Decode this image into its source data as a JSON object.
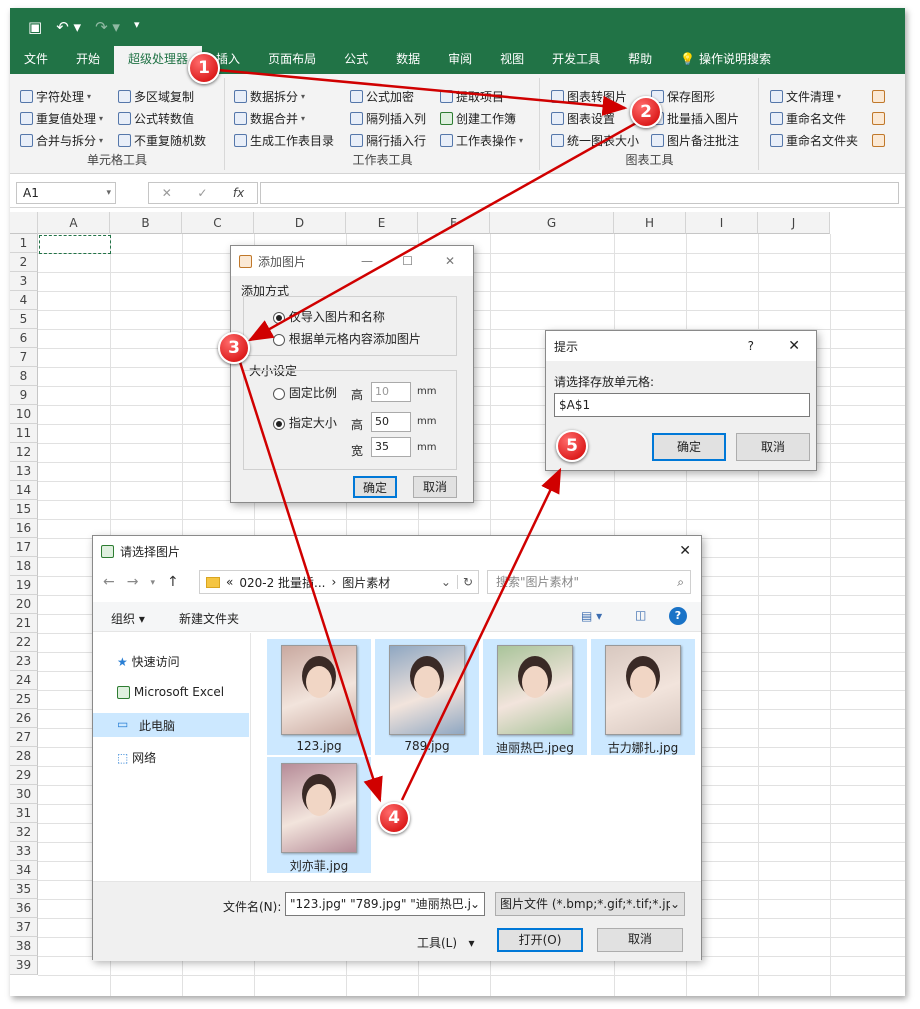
{
  "qat": {
    "save_icon": "save-icon",
    "undo_icon": "undo-icon",
    "redo_icon": "redo-icon"
  },
  "tabs": [
    "文件",
    "开始",
    "超级处理器",
    "插入",
    "页面布局",
    "公式",
    "数据",
    "审阅",
    "视图",
    "开发工具",
    "帮助"
  ],
  "tell_me": "操作说明搜索",
  "ribbon": {
    "cell_tools": {
      "title": "单元格工具",
      "items": [
        "字符处理",
        "多区域复制",
        "重复值处理",
        "公式转数值",
        "合并与拆分",
        "不重复随机数"
      ]
    },
    "sheet_tools": {
      "title": "工作表工具",
      "items": [
        "数据拆分",
        "公式加密",
        "提取项目",
        "数据合并",
        "隔列插入列",
        "创建工作簿",
        "生成工作表目录",
        "隔行插入行",
        "工作表操作"
      ]
    },
    "chart_tools": {
      "title": "图表工具",
      "items": [
        "图表转图片",
        "保存图形",
        "图表设置",
        "批量插入图片",
        "统一图表大小",
        "图片备注批注"
      ]
    },
    "file_tools": {
      "items": [
        "文件清理",
        "重命名文件",
        "重命名文件夹"
      ]
    }
  },
  "formula_bar": {
    "name_box": "A1",
    "formula": ""
  },
  "columns": [
    "A",
    "B",
    "C",
    "D",
    "E",
    "F",
    "G",
    "H",
    "I",
    "J"
  ],
  "rows": [
    "1",
    "2",
    "3",
    "4",
    "5",
    "6",
    "7",
    "8",
    "9",
    "10",
    "11",
    "12",
    "13",
    "14",
    "15",
    "16",
    "17",
    "18",
    "19",
    "20",
    "21",
    "22",
    "23",
    "24",
    "25",
    "26",
    "27",
    "28",
    "29",
    "30",
    "31",
    "32",
    "33",
    "34",
    "35",
    "36",
    "37",
    "38",
    "39"
  ],
  "add_dialog": {
    "title": "添加图片",
    "mode_label": "添加方式",
    "opt1": "仅导入图片和名称",
    "opt2": "根据单元格内容添加图片",
    "size_label": "大小设定",
    "fixed": "固定比例",
    "specified": "指定大小",
    "height_label": "高",
    "width_label": "宽",
    "fixed_height": "10",
    "height": "50",
    "width": "35",
    "unit": "mm",
    "ok": "确定",
    "cancel": "取消"
  },
  "prompt_dialog": {
    "title": "提示",
    "help": "?",
    "message": "请选择存放单元格:",
    "value": "$A$1",
    "ok": "确定",
    "cancel": "取消"
  },
  "file_dialog": {
    "title": "请选择图片",
    "path_prefix": "«",
    "path1": "020-2 批量插...",
    "path2": "图片素材",
    "search_placeholder": "搜索\"图片素材\"",
    "organize": "组织",
    "new_folder": "新建文件夹",
    "nav": [
      "快速访问",
      "Microsoft Excel",
      "此电脑",
      "网络"
    ],
    "files": [
      {
        "name": "123.jpg",
        "selected": true,
        "color": "#c9a9a0"
      },
      {
        "name": "789.jpg",
        "selected": true,
        "color": "#8fa7c2"
      },
      {
        "name": "迪丽热巴.jpeg",
        "selected": true,
        "color": "#a9c49a"
      },
      {
        "name": "古力娜扎.jpg",
        "selected": true,
        "color": "#d8c8c0"
      },
      {
        "name": "刘亦菲.jpg",
        "selected": true,
        "color": "#b68c98"
      }
    ],
    "filename_label": "文件名(N):",
    "filename": "\"123.jpg\" \"789.jpg\" \"迪丽热巴.j",
    "filetype": "图片文件 (*.bmp;*.gif;*.tif;*.jpg",
    "tools": "工具(L)",
    "open": "打开(O)",
    "cancel": "取消"
  },
  "markers": [
    "1",
    "2",
    "3",
    "4",
    "5"
  ]
}
